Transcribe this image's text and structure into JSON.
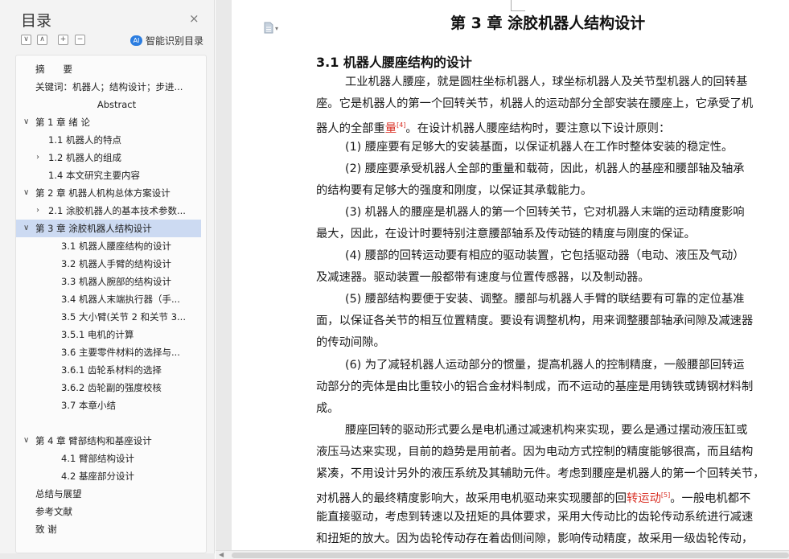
{
  "sidebar": {
    "title": "目录",
    "close_label": "×",
    "tools": [
      "∨",
      "∧",
      "+",
      "−"
    ],
    "smart_label": "智能识别目录",
    "smart_icon_text": "AI",
    "toc": [
      {
        "label": "摘　　要",
        "level": 0,
        "arrow": ""
      },
      {
        "label": "关键词：机器人；结构设计；步进...",
        "level": 0,
        "arrow": ""
      },
      {
        "label": "Abstract",
        "level": 0,
        "arrow": "",
        "center": true
      },
      {
        "label": "第 1 章  绪  论",
        "level": 0,
        "arrow": "∨"
      },
      {
        "label": "1.1 机器人的特点",
        "level": 1,
        "arrow": ""
      },
      {
        "label": "1.2 机器人的组成",
        "level": 1,
        "arrow": "›"
      },
      {
        "label": "1.4  本文研究主要内容",
        "level": 1,
        "arrow": ""
      },
      {
        "label": "第 2 章  机器人机构总体方案设计",
        "level": 0,
        "arrow": "∨"
      },
      {
        "label": "2.1 涂胶机器人的基本技术参数...",
        "level": 1,
        "arrow": "›"
      },
      {
        "label": "第 3 章  涂胶机器人结构设计",
        "level": 0,
        "arrow": "∨",
        "selected": true
      },
      {
        "label": "3.1  机器人腰座结构的设计",
        "level": 2,
        "arrow": ""
      },
      {
        "label": "3.2  机器人手臂的结构设计",
        "level": 2,
        "arrow": ""
      },
      {
        "label": "3.3     机器人腕部的结构设计",
        "level": 2,
        "arrow": ""
      },
      {
        "label": "3.4     机器人末端执行器（手...",
        "level": 2,
        "arrow": ""
      },
      {
        "label": "3.5     大小臂(关节 2 和关节 3...",
        "level": 2,
        "arrow": ""
      },
      {
        "label": "3.5.1  电机的计算",
        "level": 2,
        "arrow": ""
      },
      {
        "label": "3.6  主要零件材料的选择与...",
        "level": 2,
        "arrow": ""
      },
      {
        "label": "3.6.1   齿轮系材料的选择",
        "level": 2,
        "arrow": ""
      },
      {
        "label": "3.6.2    齿轮副的强度校核",
        "level": 2,
        "arrow": ""
      },
      {
        "label": "3.7 本章小结",
        "level": 2,
        "arrow": ""
      },
      {
        "label": "",
        "level": 0,
        "arrow": ""
      },
      {
        "label": "第 4 章    臂部结构和基座设计",
        "level": 0,
        "arrow": "∨"
      },
      {
        "label": "4.1  臂部结构设计",
        "level": 2,
        "arrow": ""
      },
      {
        "label": "4.2 基座部分设计",
        "level": 2,
        "arrow": ""
      },
      {
        "label": "总结与展望",
        "level": 0,
        "arrow": ""
      },
      {
        "label": "参考文献",
        "level": 0,
        "arrow": ""
      },
      {
        "label": "致  谢",
        "level": 0,
        "arrow": ""
      }
    ]
  },
  "document": {
    "doc_icon": "document-icon",
    "chapter_title": "第 3 章  涂胶机器人结构设计",
    "section_title": "3.1  机器人腰座结构的设计",
    "lines": [
      {
        "indent": true,
        "parts": [
          {
            "t": "工业机器人腰座，就是圆柱坐标机器人，球坐标机器人及关节型机器人的回转基"
          }
        ]
      },
      {
        "indent": false,
        "parts": [
          {
            "t": "座。它是机器人的第一个回转关节，机器人的运动部分全部安装在腰座上，它承受了机"
          }
        ]
      },
      {
        "indent": false,
        "parts": [
          {
            "t": "器人的全部重"
          },
          {
            "t": "量",
            "red": true
          },
          {
            "t": "[4]",
            "sup": true
          },
          {
            "t": "。在设计机器人腰座结构时，要注意以下设计原则："
          }
        ]
      },
      {
        "indent": true,
        "parts": [
          {
            "t": "(1)  腰座要有足够大的安装基面，以保证机器人在工作时整体安装的稳定性。"
          }
        ]
      },
      {
        "indent": true,
        "parts": [
          {
            "t": "(2)  腰座要承受机器人全部的重量和载荷，因此，机器人的基座和腰部轴及轴承"
          }
        ]
      },
      {
        "indent": false,
        "parts": [
          {
            "t": "的结构要有足够大的强度和刚度，以保证其承载能力。"
          }
        ]
      },
      {
        "indent": true,
        "parts": [
          {
            "t": "(3)  机器人的腰座是机器人的第一个回转关节，它对机器人末端的运动精度影响"
          }
        ]
      },
      {
        "indent": false,
        "parts": [
          {
            "t": "最大，因此，在设计时要特别注意腰部轴系及传动链的精度与刚度的保证。"
          }
        ]
      },
      {
        "indent": true,
        "parts": [
          {
            "t": "(4)  腰部的回转运动要有相应的驱动装置，它包括驱动器（电动、液压及气动）"
          }
        ]
      },
      {
        "indent": false,
        "parts": [
          {
            "t": "及减速器。驱动装置一般都带有速度与位置传感器，以及制动器。"
          }
        ]
      },
      {
        "indent": true,
        "parts": [
          {
            "t": "(5)  腰部结构要便于安装、调整。腰部与机器人手臂的联结要有可靠的定位基准"
          }
        ]
      },
      {
        "indent": false,
        "parts": [
          {
            "t": "面，以保证各关节的相互位置精度。要设有调整机构，用来调整腰部轴承间隙及减速器"
          }
        ]
      },
      {
        "indent": false,
        "parts": [
          {
            "t": "的传动间隙。"
          }
        ]
      },
      {
        "indent": true,
        "parts": [
          {
            "t": "(6)  为了减轻机器人运动部分的惯量，提高机器人的控制精度，一般腰部回转运"
          }
        ]
      },
      {
        "indent": false,
        "parts": [
          {
            "t": "动部分的壳体是由比重较小的铝合金材料制成，而不运动的基座是用铸铁或铸钢材料制"
          }
        ]
      },
      {
        "indent": false,
        "parts": [
          {
            "t": "成。"
          }
        ]
      },
      {
        "indent": true,
        "parts": [
          {
            "t": "腰座回转的驱动形式要么是电机通过减速机构来实现，要么是通过摆动液压缸或"
          }
        ]
      },
      {
        "indent": false,
        "parts": [
          {
            "t": "液压马达来实现，目前的趋势是用前者。因为电动方式控制的精度能够很高，而且结构"
          }
        ]
      },
      {
        "indent": false,
        "parts": [
          {
            "t": "紧凑，不用设计另外的液压系统及其辅助元件。考虑到腰座是机器人的第一个回转关节，"
          }
        ]
      },
      {
        "indent": false,
        "parts": [
          {
            "t": "对机器人的最终精度影响大，故采用电机驱动来实现腰部的回"
          },
          {
            "t": "转运动",
            "red": true
          },
          {
            "t": "[5]",
            "sup": true
          },
          {
            "t": "。一般电机都不"
          }
        ]
      },
      {
        "indent": false,
        "parts": [
          {
            "t": "能直接驱动，考虑到转速以及扭矩的具体要求，采用大传动比的齿轮传动系统进行减速"
          }
        ]
      },
      {
        "indent": false,
        "parts": [
          {
            "t": "和扭矩的放大。因为齿轮传动存在着齿侧间隙，影响传动精度，故采用一级齿轮传动，"
          }
        ]
      }
    ]
  }
}
